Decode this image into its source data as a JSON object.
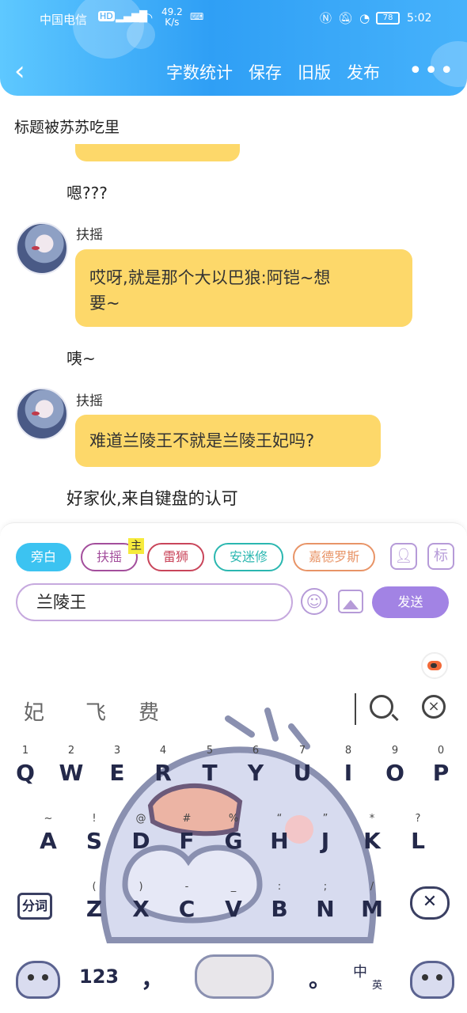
{
  "status_bar": {
    "carrier": "中国电信",
    "net_speed_value": "49.2",
    "net_speed_unit": "K/s",
    "battery": "78",
    "time": "5:02"
  },
  "header": {
    "toolbar": [
      "字数统计",
      "保存",
      "旧版",
      "发布"
    ]
  },
  "document": {
    "title": "标题被苏苏吃里"
  },
  "chat": [
    {
      "type": "narration",
      "text": "嗯???"
    },
    {
      "type": "message",
      "speaker": "扶摇",
      "text_line1": "哎呀,就是那个大以巴狼:阿铠~想",
      "text_line2": "要~"
    },
    {
      "type": "narration",
      "text": "咦~"
    },
    {
      "type": "message",
      "speaker": "扶摇",
      "text_line1": "难道兰陵王不就是兰陵王妃吗?"
    },
    {
      "type": "narration",
      "text": "好家伙,来自键盘的认可"
    }
  ],
  "editor": {
    "chips": [
      "旁白",
      "扶摇",
      "雷狮",
      "安迷修",
      "嘉德罗斯"
    ],
    "main_tag": "主",
    "tag_button": "标",
    "input_value": "兰陵王",
    "send_label": "发送"
  },
  "keyboard": {
    "candidates": [
      "妃",
      "飞",
      "费"
    ],
    "row1": [
      {
        "sub": "1",
        "key": "Q"
      },
      {
        "sub": "2",
        "key": "W"
      },
      {
        "sub": "3",
        "key": "E"
      },
      {
        "sub": "4",
        "key": "R"
      },
      {
        "sub": "5",
        "key": "T"
      },
      {
        "sub": "6",
        "key": "Y"
      },
      {
        "sub": "7",
        "key": "U"
      },
      {
        "sub": "8",
        "key": "I"
      },
      {
        "sub": "9",
        "key": "O"
      },
      {
        "sub": "0",
        "key": "P"
      }
    ],
    "row2": [
      {
        "sub": "~",
        "key": "A"
      },
      {
        "sub": "!",
        "key": "S"
      },
      {
        "sub": "@",
        "key": "D"
      },
      {
        "sub": "#",
        "key": "F"
      },
      {
        "sub": "%",
        "key": "G"
      },
      {
        "sub": "“",
        "key": "H"
      },
      {
        "sub": "”",
        "key": "J"
      },
      {
        "sub": "*",
        "key": "K"
      },
      {
        "sub": "?",
        "key": "L"
      }
    ],
    "row3": [
      {
        "sub": "(",
        "key": "Z"
      },
      {
        "sub": ")",
        "key": "X"
      },
      {
        "sub": "-",
        "key": "C"
      },
      {
        "sub": "_",
        "key": "V"
      },
      {
        "sub": ":",
        "key": "B"
      },
      {
        "sub": ";",
        "key": "N"
      },
      {
        "sub": "/",
        "key": "M"
      }
    ],
    "segment_label": "分词",
    "num_label": "123",
    "comma": "，",
    "period": "。",
    "lang_zh": "中",
    "lang_en": "英"
  }
}
